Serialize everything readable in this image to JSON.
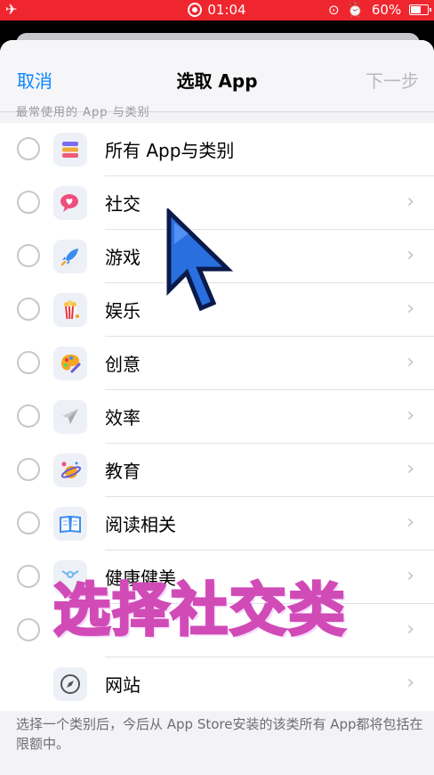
{
  "status_bar": {
    "time": "01:04",
    "battery": "60%",
    "bg_color": "#f0262f"
  },
  "nav": {
    "cancel": "取消",
    "title": "选取 App",
    "next": "下一步",
    "accent": "#0a84ff"
  },
  "ghost_text": "最常使用的 App 与类别",
  "categories": [
    {
      "label": "所有 App与类别",
      "icon": "stack-icon",
      "chevron": false
    },
    {
      "label": "社交",
      "icon": "chat-heart-icon",
      "chevron": true
    },
    {
      "label": "游戏",
      "icon": "rocket-icon",
      "chevron": true
    },
    {
      "label": "娱乐",
      "icon": "popcorn-icon",
      "chevron": true
    },
    {
      "label": "创意",
      "icon": "palette-icon",
      "chevron": true
    },
    {
      "label": "效率",
      "icon": "paper-plane-icon",
      "chevron": true
    },
    {
      "label": "教育",
      "icon": "planet-icon",
      "chevron": true
    },
    {
      "label": "阅读相关",
      "icon": "book-icon",
      "chevron": true
    },
    {
      "label": "健康健美",
      "icon": "fitness-icon",
      "chevron": true
    },
    {
      "label": "",
      "icon": "blank-icon",
      "chevron": true
    },
    {
      "label": "网站",
      "icon": "compass-icon",
      "chevron": true
    }
  ],
  "footer": "选择一个类别后，今后从 App Store安装的该类所有 App都将包括在限额中。",
  "overlay_caption": "选择社交类"
}
